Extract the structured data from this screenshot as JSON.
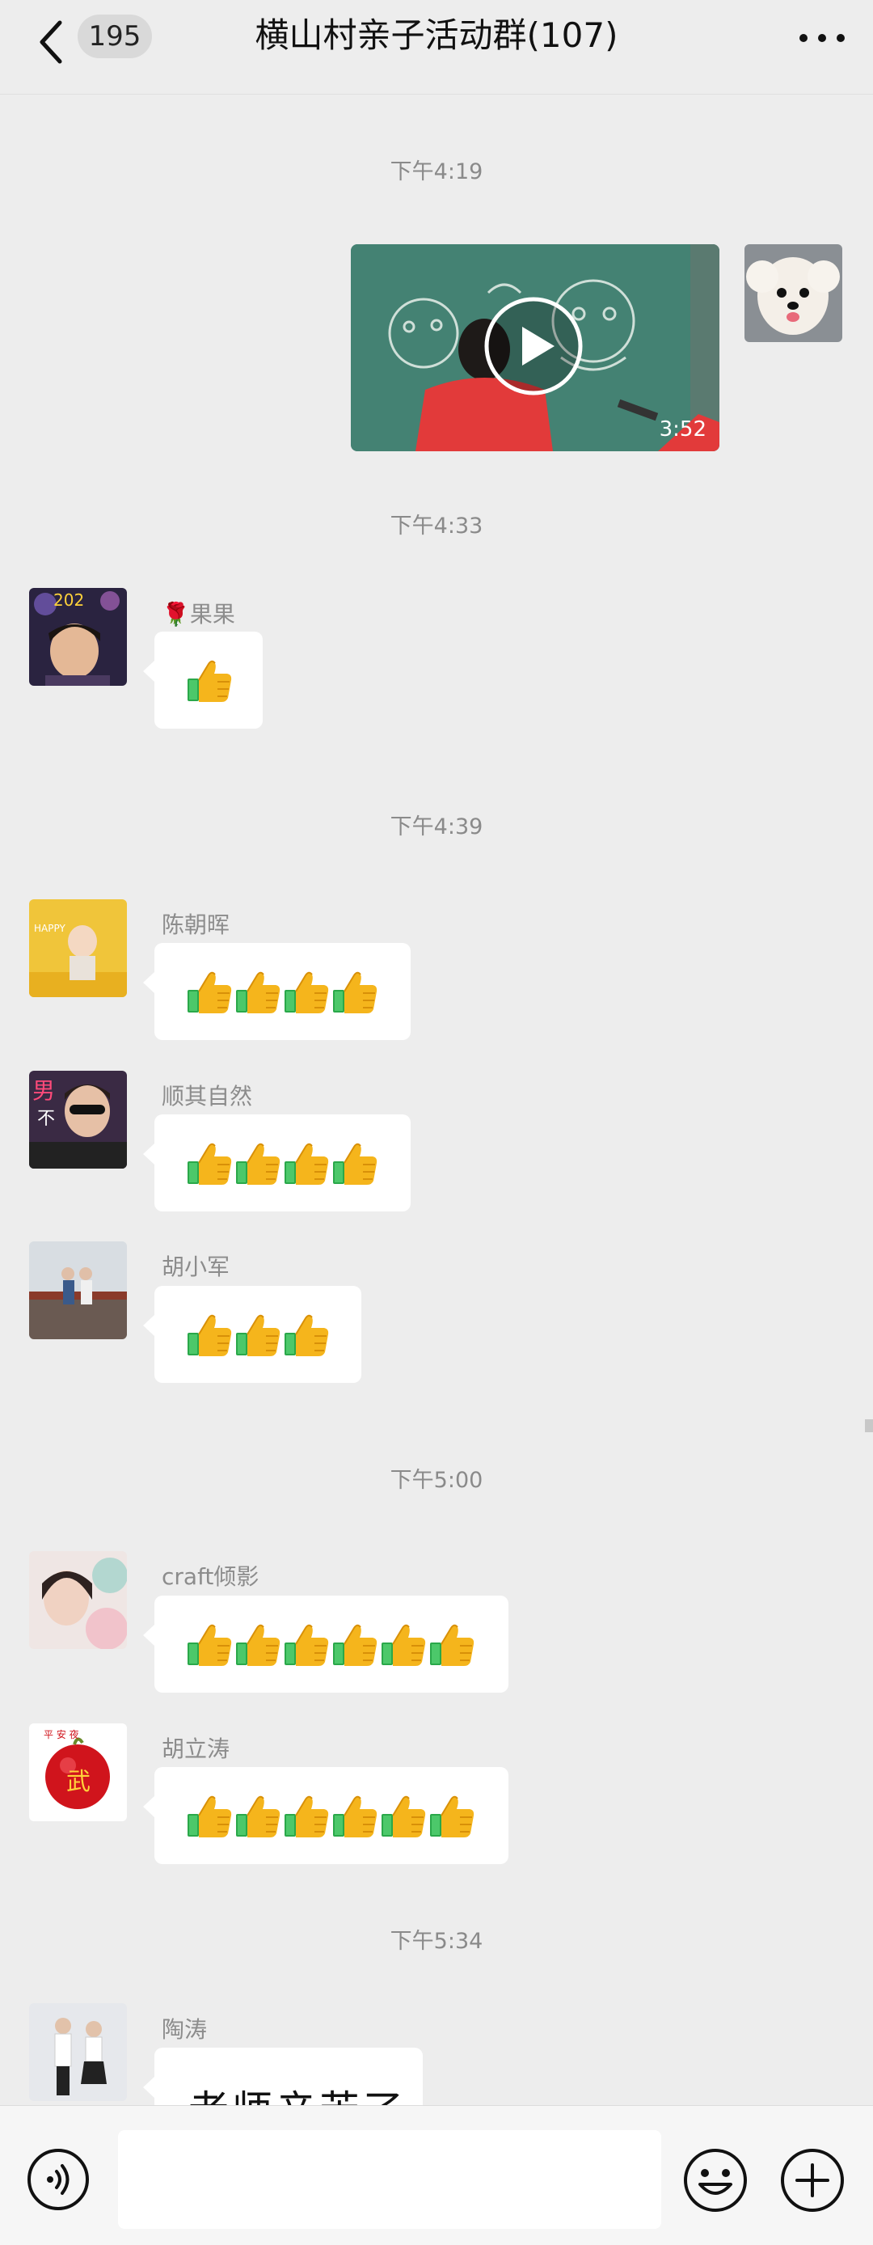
{
  "header": {
    "unread_count": "195",
    "title": "横山村亲子活动群(107)"
  },
  "messages": [
    {
      "time": "下午4:19"
    },
    {
      "video_duration": "3:52"
    },
    {
      "time": "下午4:33"
    },
    {
      "sender": "🌹果果",
      "thumbs": 1
    },
    {
      "time": "下午4:39"
    },
    {
      "sender": "陈朝晖",
      "thumbs": 4
    },
    {
      "sender": "顺其自然",
      "thumbs": 4
    },
    {
      "sender": "胡小军",
      "thumbs": 3
    },
    {
      "time": "下午5:00"
    },
    {
      "sender": "craft倾影",
      "thumbs": 6
    },
    {
      "sender": "胡立涛",
      "thumbs": 6
    },
    {
      "time": "下午5:34"
    },
    {
      "sender": "陶涛",
      "text": "老师辛苦了"
    }
  ],
  "input": {
    "placeholder": ""
  },
  "icons": {
    "back": "chevron-left-icon",
    "more": "more-dots-icon",
    "voice": "voice-icon",
    "emoji": "emoji-icon",
    "plus": "plus-icon",
    "play": "play-icon",
    "thumbs": "thumbs-up-emoji"
  },
  "colors": {
    "background": "#ededed",
    "bubble": "#ffffff",
    "timestamp": "#8a8a8a"
  }
}
